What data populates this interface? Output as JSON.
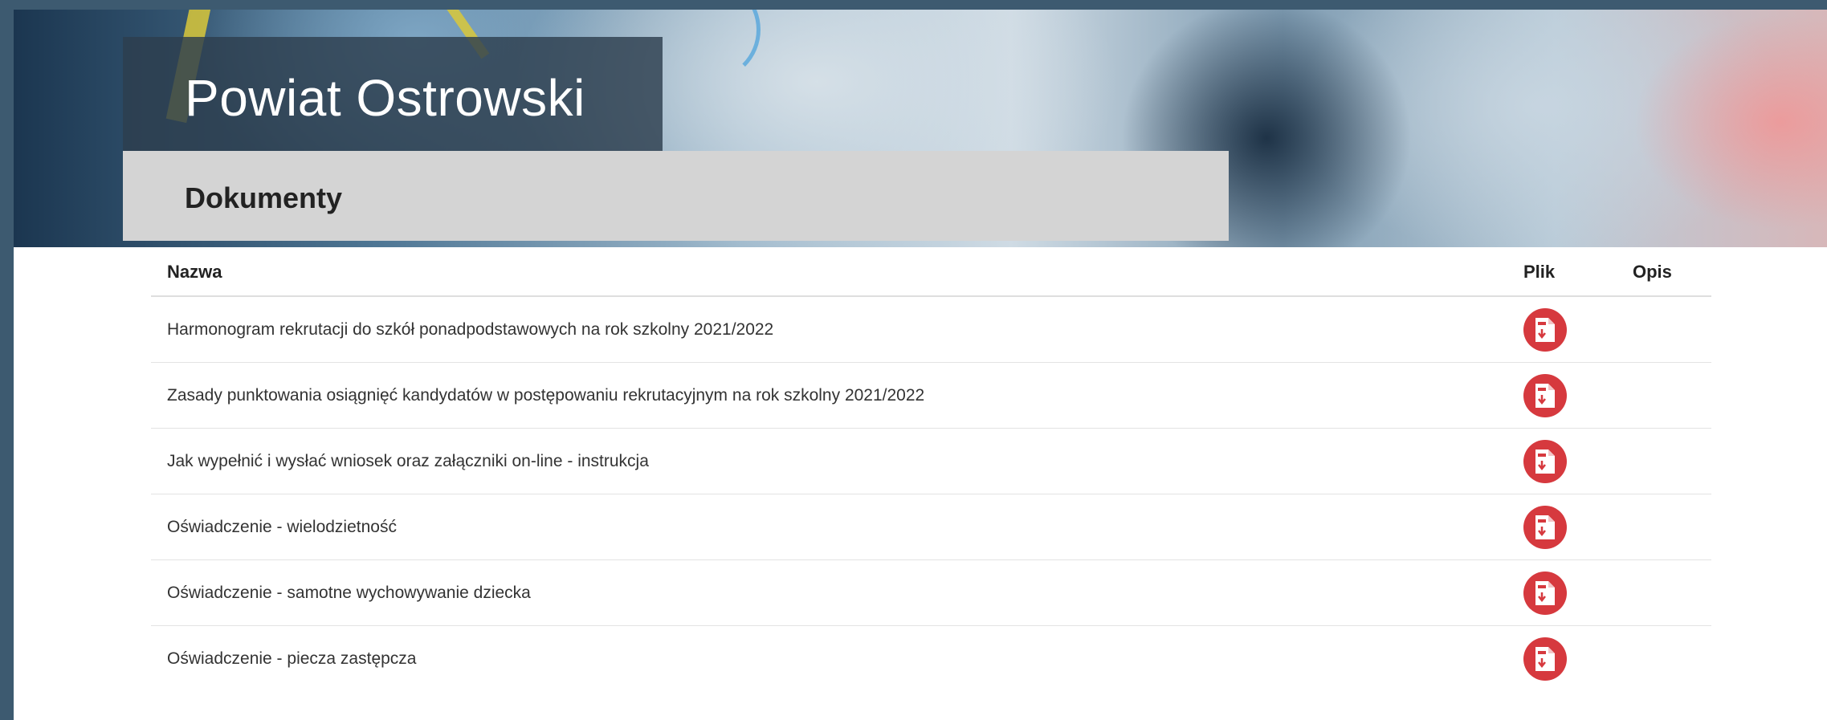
{
  "header": {
    "site_title": "Powiat Ostrowski",
    "section_title": "Dokumenty"
  },
  "table": {
    "columns": [
      "Nazwa",
      "Plik",
      "Opis"
    ],
    "rows": [
      {
        "name": "Harmonogram rekrutacji do szkół ponadpodstawowych na rok szkolny 2021/2022",
        "file_icon": "pdf-download-icon",
        "desc": ""
      },
      {
        "name": "Zasady punktowania osiągnięć kandydatów w postępowaniu rekrutacyjnym na rok szkolny 2021/2022",
        "file_icon": "pdf-download-icon",
        "desc": ""
      },
      {
        "name": "Jak wypełnić i wysłać wniosek oraz załączniki on-line - instrukcja",
        "file_icon": "pdf-download-icon",
        "desc": ""
      },
      {
        "name": "Oświadczenie - wielodzietność",
        "file_icon": "pdf-download-icon",
        "desc": ""
      },
      {
        "name": "Oświadczenie - samotne wychowywanie dziecka",
        "file_icon": "pdf-download-icon",
        "desc": ""
      },
      {
        "name": "Oświadczenie - piecza zastępcza",
        "file_icon": "pdf-download-icon",
        "desc": ""
      }
    ]
  },
  "colors": {
    "icon_red": "#d6393e",
    "page_frame": "#3d5a70"
  }
}
